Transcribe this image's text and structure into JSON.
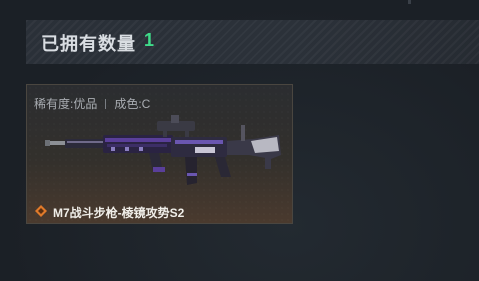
{
  "header": {
    "title": "已拥有数量",
    "count": "1"
  },
  "item_card": {
    "rarity_label": "稀有度:优品",
    "condition_label": "成色:C",
    "name": "M7战斗步枪-棱镜攻势S2",
    "weapon_icon": "rifle-icon",
    "grade_icon": "orange-diamond-icon"
  },
  "colors": {
    "count_green": "#3fdc8a",
    "grade_orange": "#e07a2a",
    "weapon_purple": "#5a3f9a"
  }
}
